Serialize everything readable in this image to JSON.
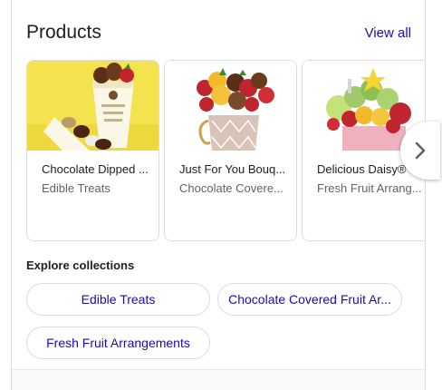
{
  "header": {
    "title": "Products",
    "view_all": "View all"
  },
  "products": [
    {
      "name": "Chocolate Dipped Fruit",
      "name_display": "Chocolate Dipped ...",
      "category": "Edible Treats",
      "image": "chocolate-dipped-fruit-image"
    },
    {
      "name": "Just For You Bouquet",
      "name_display": "Just For You Bouq...",
      "category": "Chocolate Covere...",
      "image": "bouquet-in-mug-image"
    },
    {
      "name": "Delicious Daisy®",
      "name_display": "Delicious Daisy®",
      "category": "Fresh Fruit Arrang...",
      "image": "fruit-arrangement-image"
    }
  ],
  "carousel": {
    "next_icon": "chevron-right-icon"
  },
  "collections": {
    "heading": "Explore collections",
    "chips": [
      "Edible Treats",
      "Chocolate Covered Fruit Ar...",
      "Fresh Fruit Arrangements"
    ]
  },
  "colors": {
    "link": "#1a0dab",
    "text": "#202124",
    "secondary": "#5f6368",
    "border": "#dadce0"
  }
}
